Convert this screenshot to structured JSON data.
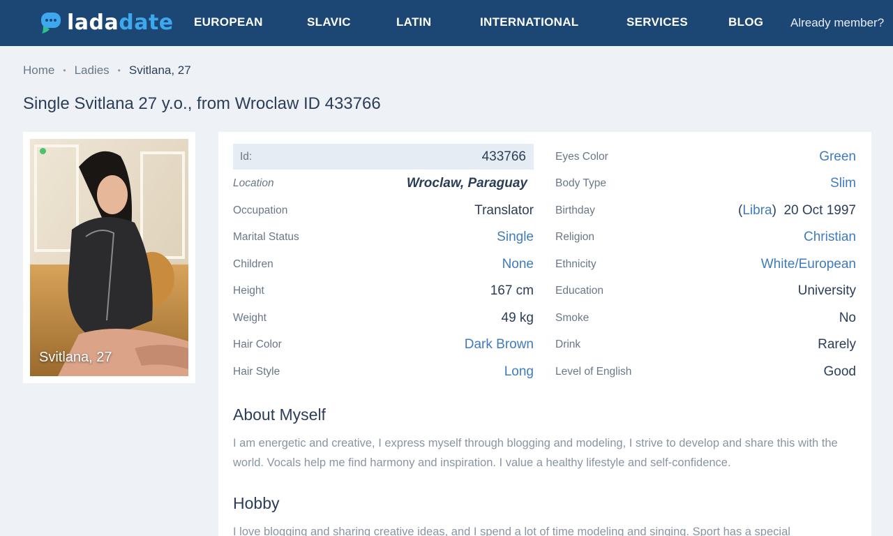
{
  "header": {
    "logo": {
      "part1": "lada",
      "part2": "date"
    },
    "nav": [
      "EUROPEAN",
      "SLAVIC",
      "LATIN",
      "INTERNATIONAL",
      "SERVICES",
      "BLOG"
    ],
    "member_link": "Already member?"
  },
  "breadcrumb": {
    "home": "Home",
    "ladies": "Ladies",
    "current": "Svitlana, 27",
    "separator": "•"
  },
  "title": "Single Svitlana 27 y.o., from Wroclaw ID 433766",
  "photo": {
    "caption": "Svitlana, 27",
    "online_color": "#4cc26a"
  },
  "profile": {
    "left": [
      {
        "label": "Id:",
        "value": "433766"
      },
      {
        "label": "Location",
        "value": "Wroclaw, Paraguay"
      },
      {
        "label": "Occupation",
        "value": "Translator"
      },
      {
        "label": "Marital Status",
        "value": "Single"
      },
      {
        "label": "Children",
        "value": "None"
      },
      {
        "label": "Height",
        "value": "167 cm"
      },
      {
        "label": "Weight",
        "value": "49 kg"
      },
      {
        "label": "Hair Color",
        "value": "Dark Brown"
      },
      {
        "label": "Hair Style",
        "value": "Long"
      }
    ],
    "right": [
      {
        "label": "Eyes Color",
        "value": "Green"
      },
      {
        "label": "Body Type",
        "value": "Slim"
      },
      {
        "label": "Birthday",
        "zodiac": "Libra",
        "value": "20 Oct 1997"
      },
      {
        "label": "Religion",
        "value": "Christian"
      },
      {
        "label": "Ethnicity",
        "value": "White/European"
      },
      {
        "label": "Education",
        "value": "University"
      },
      {
        "label": "Smoke",
        "value": "No"
      },
      {
        "label": "Drink",
        "value": "Rarely"
      },
      {
        "label": "Level of English",
        "value": "Good"
      }
    ]
  },
  "about": {
    "title": "About Myself",
    "text": "I am energetic and creative, I express myself through blogging and modeling, I strive to develop and share this with the world. Vocals help me find harmony and inspiration. I value a healthy lifestyle and self-confidence."
  },
  "hobby": {
    "title": "Hobby",
    "text": "I love blogging and sharing creative ideas, and I spend a lot of time modeling and singing. Sport has a special"
  },
  "colors": {
    "header_bg": "#1c4674",
    "accent": "#3ea8ee",
    "link": "#3f7bbf",
    "page_bg": "#eef2f7"
  }
}
